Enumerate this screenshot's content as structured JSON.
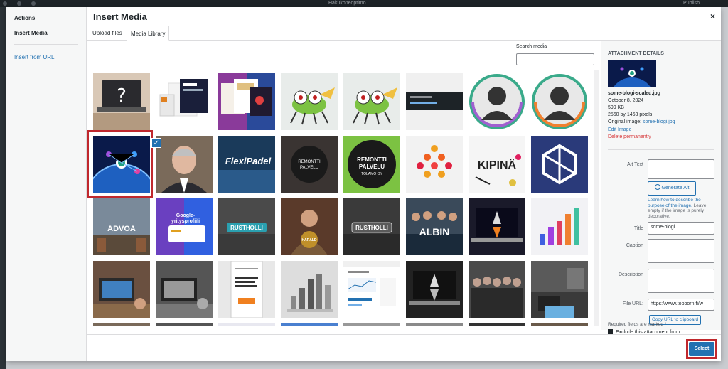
{
  "topbar": {
    "center_text": "Hakukoneoptimo...",
    "right_text": "Publish"
  },
  "modal": {
    "title": "Insert Media",
    "close_label": "×",
    "menu": {
      "heading": "Actions",
      "items": [
        "Insert Media",
        "Insert from URL"
      ]
    },
    "tabs": [
      "Upload files",
      "Media Library"
    ],
    "active_tab": "Media Library",
    "search": {
      "label": "Search media",
      "value": ""
    }
  },
  "thumbnail_icons": [
    "laptop-question-image",
    "website-screens-image",
    "website-collage-image",
    "cartoon-bug-image",
    "cartoon-bug-image",
    "dark-screenshot-image",
    "avatar-placeholder-image",
    "avatar-placeholder-image",
    "earth-network-image",
    "man-portrait-image",
    "flexipadel-logo-image",
    "remontti-dark-logo-image",
    "remontti-green-logo-image",
    "dots-logo-image",
    "kipina-logo-image",
    "hexagon-logo-image",
    "advoa-city-image",
    "google-profile-image",
    "rustholli-sign-image",
    "harald-man-image",
    "rustholli-dark-image",
    "albin-team-image",
    "rocket-laptop-image",
    "bar-chart-3d-image",
    "cafe-laptop-image",
    "bw-cafe-laptop-image",
    "phone-article-image",
    "bw-chart-image",
    "analytics-screenshot-image",
    "bw-rocket-image",
    "team-group-image",
    "kitchen-interior-image"
  ],
  "selected_index": 8,
  "checkmark": "✓",
  "details": {
    "heading": "Attachment Details",
    "filename": "some-blogi-scaled.jpg",
    "date": "October 8, 2024",
    "size": "599 KB",
    "dimensions": "2560 by 1463 pixels",
    "original_label": "Original image: ",
    "original_link": "some-blogi.jpg",
    "edit_link": "Edit Image",
    "delete_link": "Delete permanently",
    "alt_label": "Alt Text",
    "alt_value": "",
    "generate_label": "Generate Alt",
    "help_link": "Learn how to describe the purpose of the image.",
    "help_text": " Leave empty if the image is purely decorative.",
    "title_label": "Title",
    "title_value": "some-blogi",
    "caption_label": "Caption",
    "caption_value": "",
    "description_label": "Description",
    "description_value": "",
    "fileurl_label": "File URL:",
    "fileurl_value": "https://www.topborn.fi/w",
    "copy_label": "Copy URL to clipboard",
    "required_text": "Required fields are marked *",
    "exclude_text": "Exclude this attachment from"
  },
  "toolbar": {
    "select_label": "Select"
  },
  "colors": {
    "accent": "#2271b1",
    "highlight": "#c0282d",
    "delete": "#d63638"
  }
}
